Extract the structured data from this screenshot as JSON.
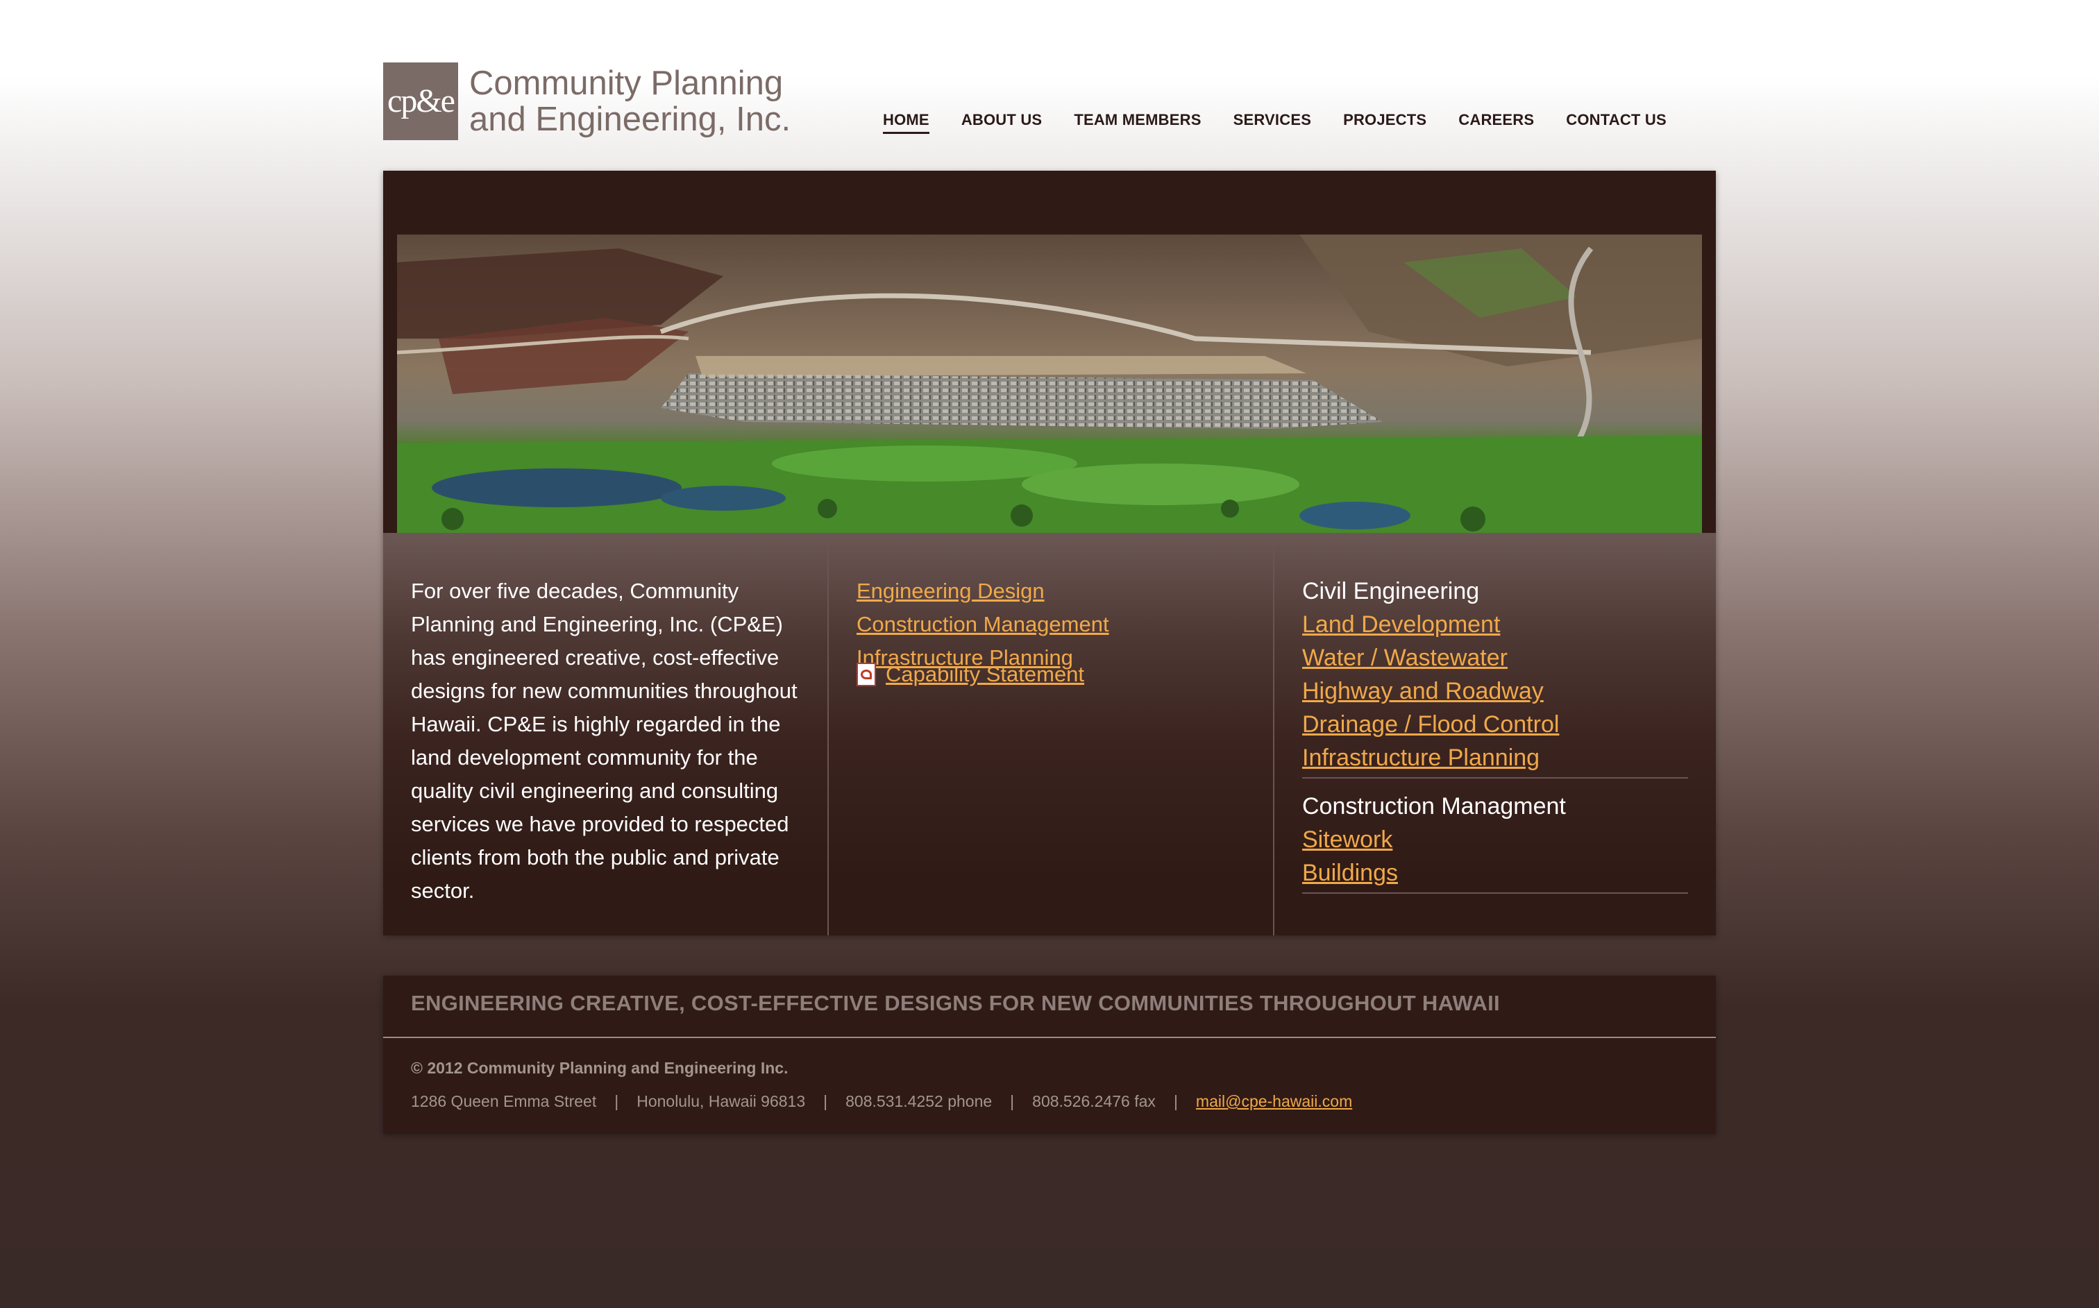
{
  "header": {
    "logo_mark": "cp&e",
    "logo_line1": "Community Planning",
    "logo_line2": "and Engineering, Inc.",
    "nav": [
      {
        "label": "HOME",
        "active": true
      },
      {
        "label": "ABOUT US"
      },
      {
        "label": "TEAM MEMBERS"
      },
      {
        "label": "SERVICES"
      },
      {
        "label": "PROJECTS"
      },
      {
        "label": "CAREERS"
      },
      {
        "label": "CONTACT US"
      }
    ]
  },
  "intro": "For over five decades, Community Planning and Engineering, Inc. (CP&E) has engineered creative, cost-effective designs for new communities throughout Hawaii. CP&E is highly regarded in the land development community for the quality civil engineering and consulting services we have provided to respected clients from both the public and private sector.",
  "services": {
    "links": [
      "Engineering Design",
      "Construction Management",
      "Infrastructure Planning"
    ],
    "capability": "Capability Statement",
    "capability_icon": "pdf-icon"
  },
  "categories": [
    {
      "title": "Civil Engineering",
      "items": [
        "Land Development",
        "Water / Wastewater",
        "Highway and Roadway",
        "Drainage / Flood Control",
        "Infrastructure Planning"
      ]
    },
    {
      "title": "Construction Managment",
      "items": [
        "Sitework",
        "Buildings"
      ]
    }
  ],
  "footer": {
    "tagline": "ENGINEERING CREATIVE, COST-EFFECTIVE DESIGNS FOR NEW COMMUNITIES THROUGHOUT HAWAII",
    "copyright": "© 2012 Community Planning and Engineering Inc.",
    "address": "1286 Queen Emma Street",
    "city": "Honolulu, Hawaii 96813",
    "phone": "808.531.4252 phone",
    "fax": "808.526.2476 fax",
    "email": "mail@cpe-hawaii.com",
    "separator": "|"
  },
  "colors": {
    "link": "#f0a94a",
    "panel": "#2f1a15",
    "logo": "#7b6b67"
  }
}
